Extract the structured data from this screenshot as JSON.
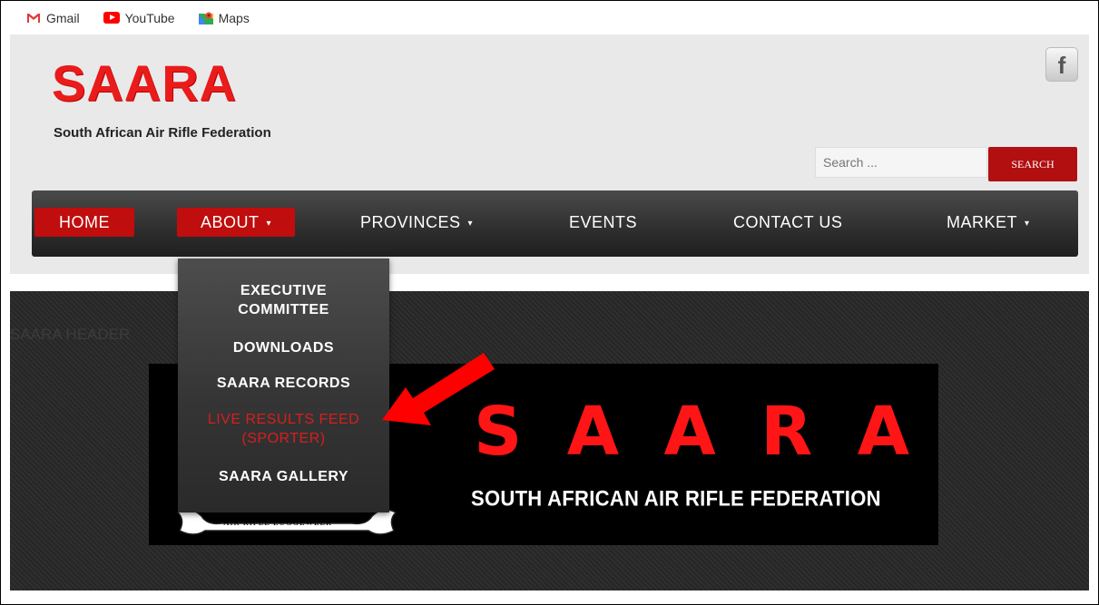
{
  "bookmarks": [
    {
      "label": "Gmail",
      "icon": "gmail-icon"
    },
    {
      "label": "YouTube",
      "icon": "youtube-icon"
    },
    {
      "label": "Maps",
      "icon": "maps-icon"
    }
  ],
  "header": {
    "logo_title": "SAARA",
    "logo_subtitle": "South African Air Rifle Federation",
    "facebook_label": "f",
    "search_placeholder": "Search ...",
    "search_button": "SEARCH"
  },
  "nav": [
    {
      "label": "HOME",
      "active": true,
      "has_caret": false
    },
    {
      "label": "ABOUT",
      "active": true,
      "has_caret": true
    },
    {
      "label": "PROVINCES",
      "active": false,
      "has_caret": true
    },
    {
      "label": "EVENTS",
      "active": false,
      "has_caret": false
    },
    {
      "label": "CONTACT US",
      "active": false,
      "has_caret": false
    },
    {
      "label": "MARKET",
      "active": false,
      "has_caret": true
    }
  ],
  "caret": "▾",
  "about_dropdown": [
    {
      "label_lines": [
        "EXECUTIVE",
        "COMMITTEE"
      ],
      "highlighted": false
    },
    {
      "label_lines": [
        "DOWNLOADS"
      ],
      "highlighted": false
    },
    {
      "label_lines": [
        "SAARA RECORDS"
      ],
      "highlighted": false
    },
    {
      "label_lines": [
        "LIVE RESULTS FEED",
        "(SPORTER)"
      ],
      "highlighted": true
    },
    {
      "label_lines": [
        "SAARA GALLERY"
      ],
      "highlighted": false
    }
  ],
  "banner": {
    "caption": "SAARA HEADER",
    "letters": [
      "S",
      "A",
      "A",
      "R",
      "A"
    ],
    "subtitle": "SOUTH AFRICAN AIR RIFLE FEDERATION",
    "ribbon_text": "AIR RIFLE   LUGGEWEER"
  },
  "colors": {
    "accent_red": "#c00d0d",
    "logo_red": "#ea1b1b",
    "highlight_red": "#d81e1e",
    "arrow_red": "#ff0000"
  }
}
